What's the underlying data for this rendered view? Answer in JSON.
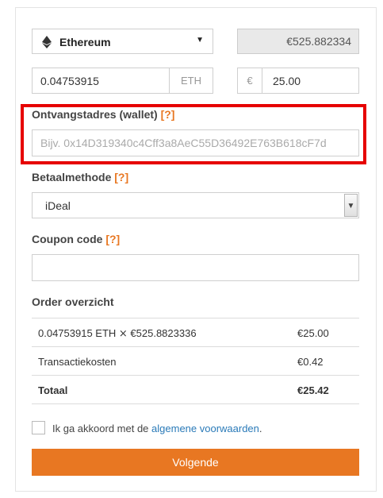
{
  "crypto": {
    "selected": "Ethereum",
    "rate": "€525.882334"
  },
  "amount": {
    "eth_value": "0.04753915",
    "eth_unit": "ETH",
    "eur_symbol": "€",
    "eur_value": "25.00"
  },
  "wallet": {
    "label": "Ontvangstadres (wallet)",
    "help": "[?]",
    "placeholder": "Bijv. 0x14D319340c4Cff3a8AeC55D36492E763B618cF7d"
  },
  "payment": {
    "label": "Betaalmethode",
    "help": "[?]",
    "selected": "iDeal"
  },
  "coupon": {
    "label": "Coupon code",
    "help": "[?]",
    "value": ""
  },
  "order": {
    "title": "Order overzicht",
    "rows": [
      {
        "desc": "0.04753915 ETH ⨯ €525.8823336",
        "price": "€25.00"
      },
      {
        "desc": "Transactiekosten",
        "price": "€0.42"
      },
      {
        "desc": "Totaal",
        "price": "€25.42"
      }
    ]
  },
  "terms": {
    "text": "Ik ga akkoord met de",
    "link": "algemene voorwaarden",
    "suffix": "."
  },
  "submit_label": "Volgende",
  "colors": {
    "accent": "#e87722",
    "highlight": "#e60000",
    "link": "#2a7ab8"
  }
}
